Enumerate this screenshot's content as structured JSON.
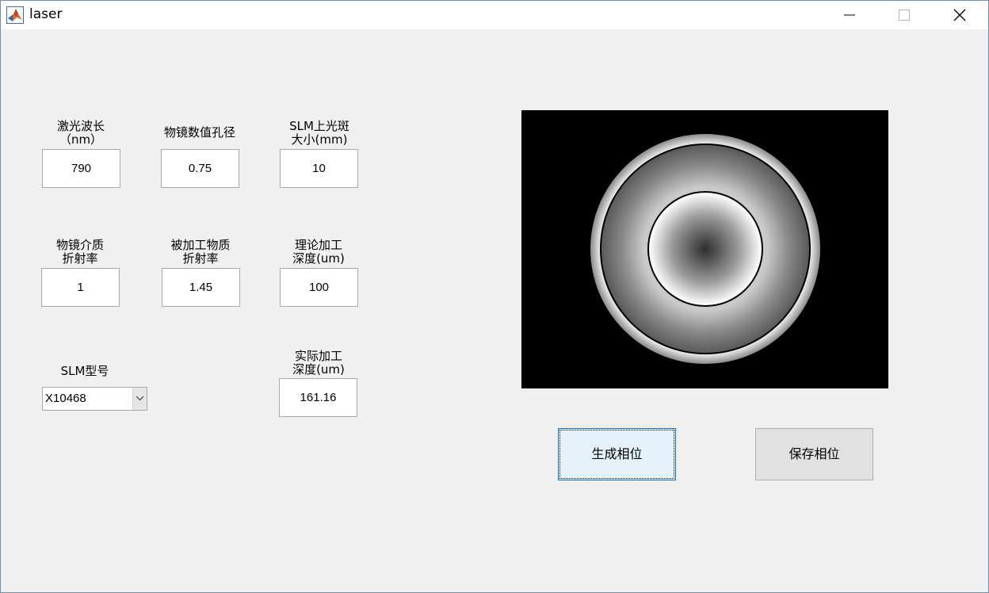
{
  "window": {
    "title": "laser"
  },
  "titlebar_icons": {
    "app": "matlab-icon",
    "minimize": "minimize-icon",
    "maximize": "maximize-icon",
    "close": "close-icon"
  },
  "params": {
    "wavelength": {
      "label_line1": "激光波长",
      "label_line2": "（nm）",
      "value": "790"
    },
    "na": {
      "label_line1": "物镜数值孔径",
      "value": "0.75"
    },
    "spot_size": {
      "label_line1": "SLM上光斑",
      "label_line2": "大小(mm)",
      "value": "10"
    },
    "medium_index": {
      "label_line1": "物镜介质",
      "label_line2": "折射率",
      "value": "1"
    },
    "material_index": {
      "label_line1": "被加工物质",
      "label_line2": "折射率",
      "value": "1.45"
    },
    "theory_depth": {
      "label_line1": "理论加工",
      "label_line2": "深度(um)",
      "value": "100"
    },
    "actual_depth": {
      "label_line1": "实际加工",
      "label_line2": "深度(um)",
      "value": "161.16"
    }
  },
  "slm_model": {
    "label": "SLM型号",
    "selected": "X10468"
  },
  "buttons": {
    "generate": "生成相位",
    "save": "保存相位"
  },
  "colors": {
    "window_bg": "#f0f0f0",
    "focus_border": "#0078d7",
    "focus_bg": "#e5f1fb"
  }
}
